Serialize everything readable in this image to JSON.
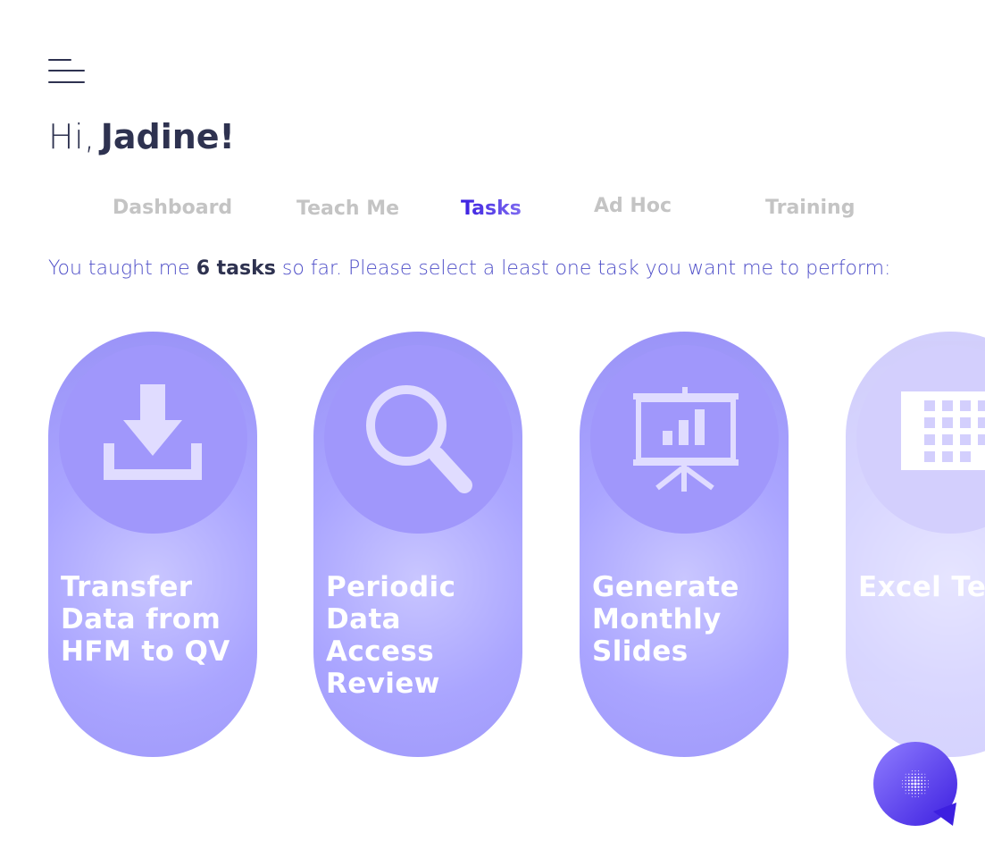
{
  "greeting": {
    "hi": "Hi,",
    "name": "Jadine!"
  },
  "tabs": [
    {
      "label": "Dashboard",
      "active": false
    },
    {
      "label": "Teach Me",
      "active": false
    },
    {
      "label": "Tasks",
      "active": true
    },
    {
      "label": "Ad Hoc",
      "active": false
    },
    {
      "label": "Training",
      "active": false
    }
  ],
  "intro": {
    "prefix": "You taught me",
    "count": "6 tasks",
    "suffix": "so far. Please select a least one task you want me to perform:"
  },
  "tasks": [
    {
      "title": "Transfer Data from HFM to QV",
      "icon": "download-icon"
    },
    {
      "title": "Periodic Data Access Review",
      "icon": "search-icon"
    },
    {
      "title": "Generate Monthly Slides",
      "icon": "presentation-icon"
    },
    {
      "title": "Excel Template Generation",
      "icon": "spreadsheet-icon"
    }
  ],
  "colors": {
    "accent": "#4227d6",
    "card": "#a49cf8",
    "text": "#2e3250",
    "inactive_tab": "#c4c4c4"
  }
}
